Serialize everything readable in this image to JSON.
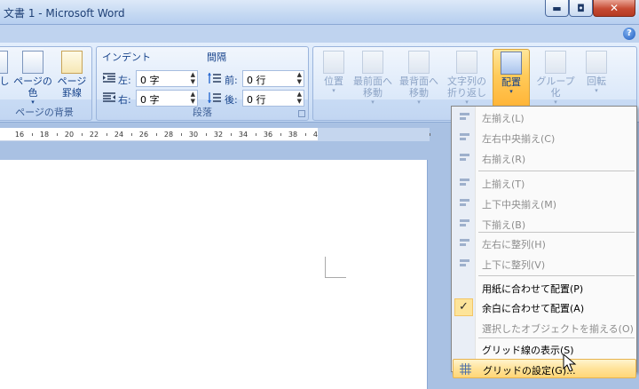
{
  "window": {
    "title": "文書 1 - Microsoft Word",
    "min_glyph": "▬",
    "max_glyph": "◘",
    "close_glyph": "✕"
  },
  "help_glyph": "?",
  "page_bg_group": {
    "label": "ページの背景",
    "buttons": [
      "し",
      "ページの\n色",
      "ページ\n罫線"
    ]
  },
  "paragraph_group": {
    "label": "段落",
    "indent_header": "インデント",
    "spacing_header": "間隔",
    "left_label": "左:",
    "right_label": "右:",
    "before_label": "前:",
    "after_label": "後:",
    "left_value": "0 字",
    "right_value": "0 字",
    "before_value": "0 行",
    "after_value": "0 行"
  },
  "arrange_group": {
    "buttons": [
      {
        "label": "位置"
      },
      {
        "label": "最前面へ\n移動"
      },
      {
        "label": "最背面へ\n移動"
      },
      {
        "label": "文字列の\n折り返し"
      },
      {
        "label": "配置"
      },
      {
        "label": "グループ化"
      },
      {
        "label": "回転"
      }
    ]
  },
  "ruler": {
    "ticks": [
      "16",
      "18",
      "20",
      "22",
      "24",
      "26",
      "28",
      "30",
      "32",
      "34",
      "36",
      "38",
      "40",
      "42",
      "44",
      "46",
      "48"
    ]
  },
  "menu": {
    "items": [
      {
        "label": "左揃え(L)",
        "enabled": false,
        "icon": "align-left-icon"
      },
      {
        "label": "左右中央揃え(C)",
        "enabled": false,
        "icon": "align-center-icon"
      },
      {
        "label": "右揃え(R)",
        "enabled": false,
        "icon": "align-right-icon"
      },
      {
        "label": "上揃え(T)",
        "enabled": false,
        "icon": "align-top-icon"
      },
      {
        "label": "上下中央揃え(M)",
        "enabled": false,
        "icon": "align-middle-icon"
      },
      {
        "label": "下揃え(B)",
        "enabled": false,
        "icon": "align-bottom-icon"
      },
      {
        "label": "左右に整列(H)",
        "enabled": false,
        "icon": "distribute-horizontal-icon"
      },
      {
        "label": "上下に整列(V)",
        "enabled": false,
        "icon": "distribute-vertical-icon"
      },
      {
        "label": "用紙に合わせて配置(P)",
        "enabled": true,
        "icon": ""
      },
      {
        "label": "余白に合わせて配置(A)",
        "enabled": true,
        "checked": true,
        "icon": "checkmark-icon"
      },
      {
        "label": "選択したオブジェクトを揃える(O)",
        "enabled": false,
        "icon": ""
      },
      {
        "label": "グリッド線の表示(S)",
        "enabled": true,
        "icon": ""
      },
      {
        "label": "グリッドの設定(G)...",
        "enabled": true,
        "hover": true,
        "icon": "grid-icon"
      }
    ],
    "check_glyph": "✓"
  }
}
